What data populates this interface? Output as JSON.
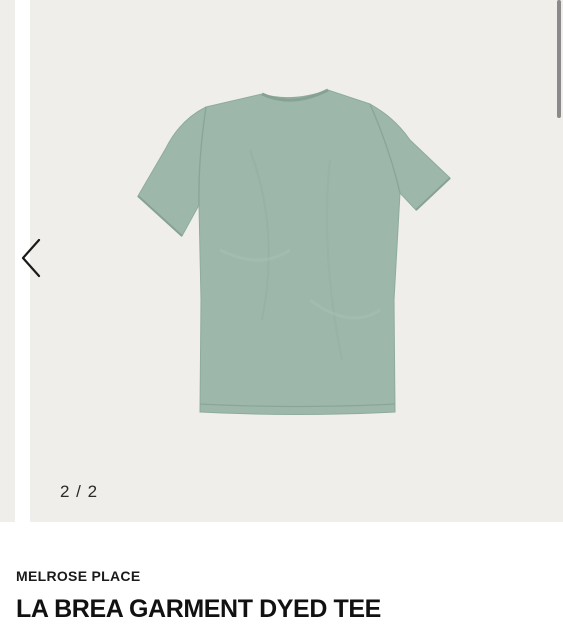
{
  "gallery": {
    "counter": "2 / 2",
    "shirt_color": "#9db8aa",
    "background_color": "#efeeea",
    "prev_icon": "chevron-left-icon"
  },
  "product": {
    "brand": "MELROSE PLACE",
    "name": "LA BREA GARMENT DYED TEE"
  }
}
